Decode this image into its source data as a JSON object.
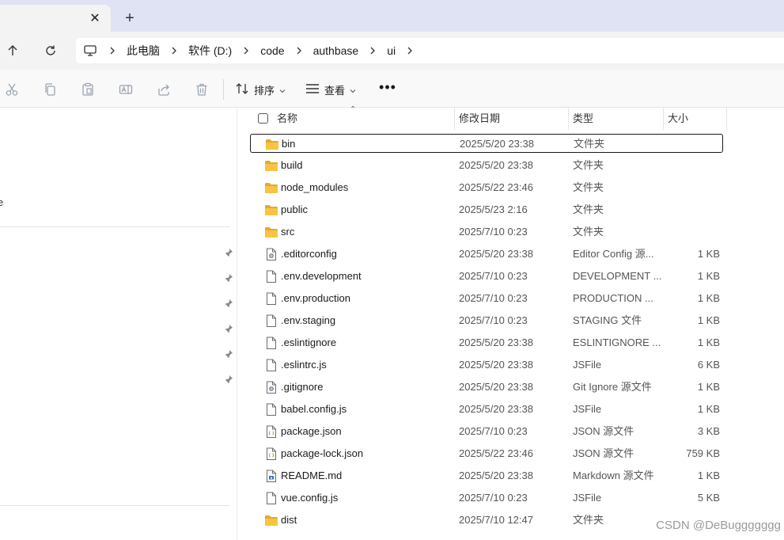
{
  "tab": {
    "close_glyph": "✕",
    "new_tab_glyph": "+"
  },
  "nav_buttons": [
    "up-arrow-icon",
    "refresh-icon"
  ],
  "breadcrumb": {
    "root_icon": "computer-icon",
    "items": [
      "此电脑",
      "软件 (D:)",
      "code",
      "authbase",
      "ui"
    ]
  },
  "toolbar": {
    "icons": [
      "cut-icon",
      "copy-icon",
      "paste-icon",
      "rename-icon",
      "share-icon",
      "delete-icon"
    ],
    "sort_label": "排序",
    "view_label": "查看",
    "more_glyph": "•••"
  },
  "navpane": {
    "fragment_text": "e",
    "pinned_count": 6
  },
  "columns": {
    "name": "名称",
    "date": "修改日期",
    "type": "类型",
    "size": "大小",
    "sort_glyph": "⌃"
  },
  "files": [
    {
      "name": "bin",
      "date": "2025/5/20 23:38",
      "type": "文件夹",
      "size": "",
      "icon": "folder"
    },
    {
      "name": "build",
      "date": "2025/5/20 23:38",
      "type": "文件夹",
      "size": "",
      "icon": "folder"
    },
    {
      "name": "node_modules",
      "date": "2025/5/22 23:46",
      "type": "文件夹",
      "size": "",
      "icon": "folder"
    },
    {
      "name": "public",
      "date": "2025/5/23 2:16",
      "type": "文件夹",
      "size": "",
      "icon": "folder"
    },
    {
      "name": "src",
      "date": "2025/7/10 0:23",
      "type": "文件夹",
      "size": "",
      "icon": "folder"
    },
    {
      "name": ".editorconfig",
      "date": "2025/5/20 23:38",
      "type": "Editor Config 源...",
      "size": "1 KB",
      "icon": "config"
    },
    {
      "name": ".env.development",
      "date": "2025/7/10 0:23",
      "type": "DEVELOPMENT ...",
      "size": "1 KB",
      "icon": "file"
    },
    {
      "name": ".env.production",
      "date": "2025/7/10 0:23",
      "type": "PRODUCTION ...",
      "size": "1 KB",
      "icon": "file"
    },
    {
      "name": ".env.staging",
      "date": "2025/7/10 0:23",
      "type": "STAGING 文件",
      "size": "1 KB",
      "icon": "file"
    },
    {
      "name": ".eslintignore",
      "date": "2025/5/20 23:38",
      "type": "ESLINTIGNORE ...",
      "size": "1 KB",
      "icon": "file"
    },
    {
      "name": ".eslintrc.js",
      "date": "2025/5/20 23:38",
      "type": "JSFile",
      "size": "6 KB",
      "icon": "file"
    },
    {
      "name": ".gitignore",
      "date": "2025/5/20 23:38",
      "type": "Git Ignore 源文件",
      "size": "1 KB",
      "icon": "config"
    },
    {
      "name": "babel.config.js",
      "date": "2025/5/20 23:38",
      "type": "JSFile",
      "size": "1 KB",
      "icon": "file"
    },
    {
      "name": "package.json",
      "date": "2025/7/10 0:23",
      "type": "JSON 源文件",
      "size": "3 KB",
      "icon": "json"
    },
    {
      "name": "package-lock.json",
      "date": "2025/5/22 23:46",
      "type": "JSON 源文件",
      "size": "759 KB",
      "icon": "json"
    },
    {
      "name": "README.md",
      "date": "2025/5/20 23:38",
      "type": "Markdown 源文件",
      "size": "1 KB",
      "icon": "markdown"
    },
    {
      "name": "vue.config.js",
      "date": "2025/7/10 0:23",
      "type": "JSFile",
      "size": "5 KB",
      "icon": "file"
    },
    {
      "name": "dist",
      "date": "2025/7/10 12:47",
      "type": "文件夹",
      "size": "",
      "icon": "folder"
    }
  ],
  "selected_row": 0,
  "watermark": "CSDN @DeBuggggggg",
  "colors": {
    "tabstrip": "#dfe3f3",
    "folder": "#f7c443",
    "folder_dark": "#e6a92a",
    "icon_gray": "#9aa3b2"
  }
}
